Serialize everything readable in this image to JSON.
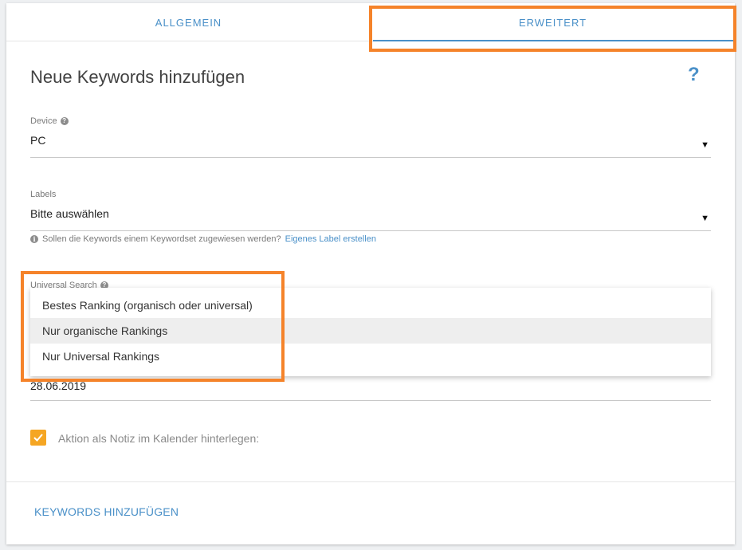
{
  "tabs": [
    {
      "label": "ALLGEMEIN"
    },
    {
      "label": "ERWEITERT"
    }
  ],
  "header": {
    "title": "Neue Keywords hinzufügen",
    "help_symbol": "?"
  },
  "device": {
    "label": "Device",
    "value": "PC"
  },
  "labels": {
    "label": "Labels",
    "value": "Bitte auswählen",
    "hint_text": "Sollen die Keywords einem Keywordset zugewiesen werden?",
    "hint_link": "Eigenes Label erstellen"
  },
  "universal_search": {
    "label": "Universal Search",
    "options": [
      "Bestes Ranking (organisch oder universal)",
      "Nur organische Rankings",
      "Nur Universal Rankings"
    ],
    "highlighted_option": "Nur organische Rankings"
  },
  "date_field": {
    "value": "28.06.2019"
  },
  "note": {
    "checked": true,
    "label": "Aktion als Notiz im Kalender hinterlegen:"
  },
  "footer": {
    "submit_label": "KEYWORDS HINZUFÜGEN"
  },
  "colors": {
    "accent": "#4a90c8",
    "highlight": "#f5832a",
    "checkbox": "#f5a623"
  },
  "icons": [
    "help-icon",
    "question-mark-icon",
    "dropdown-arrow-icon",
    "info-icon",
    "checkmark-icon"
  ]
}
